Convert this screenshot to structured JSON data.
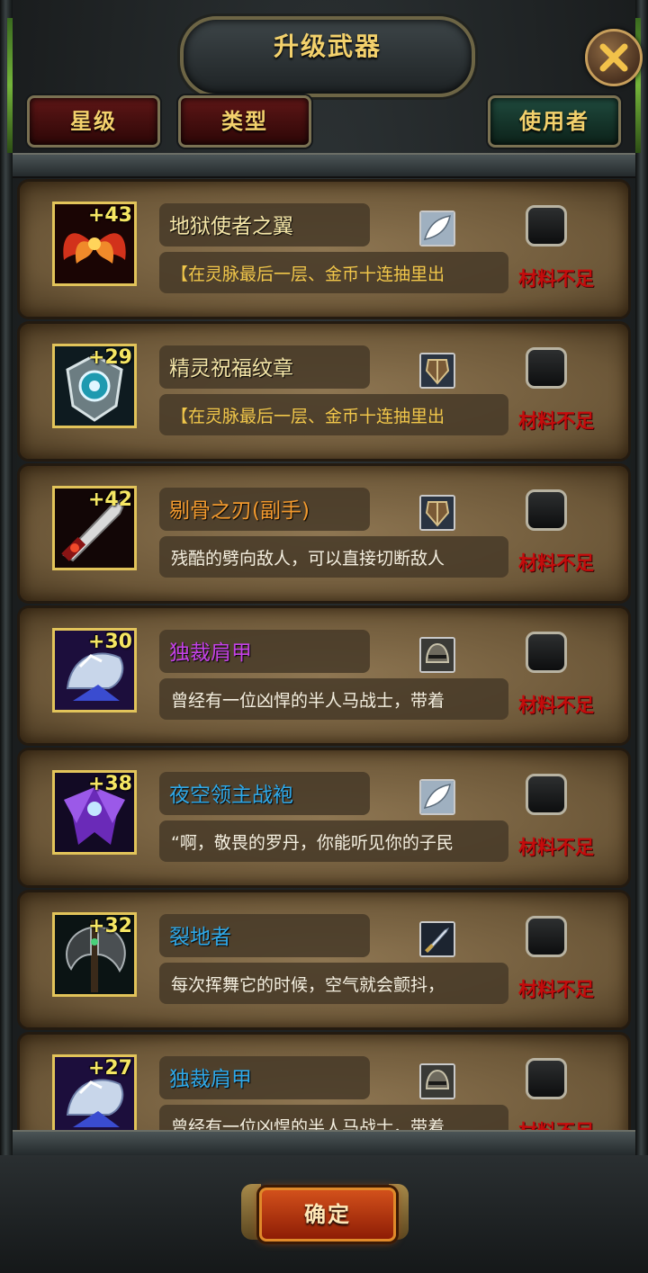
{
  "header": {
    "title": "升级武器",
    "close_icon": "close-x-icon"
  },
  "filters": [
    {
      "label": "星级",
      "color": "#5e1616"
    },
    {
      "label": "类型",
      "color": "#5e1616"
    },
    {
      "label": "使用者",
      "color": "#1f4a3d"
    }
  ],
  "items": [
    {
      "name": "地狱使者之翼",
      "plus": "+43",
      "name_color": "#f5e6a8",
      "desc": "【在灵脉最后一层、金币十连抽里出",
      "desc_color": "#f0c64a",
      "type_icon": "wing-type-icon",
      "status": "材料不足",
      "art": "wings-red"
    },
    {
      "name": "精灵祝福纹章",
      "plus": "+29",
      "name_color": "#f5e6a8",
      "desc": "【在灵脉最后一层、金币十连抽里出",
      "desc_color": "#f0c64a",
      "type_icon": "shield-type-icon",
      "status": "材料不足",
      "art": "emblem"
    },
    {
      "name": "剔骨之刃(副手)",
      "plus": "+42",
      "name_color": "#f39a2e",
      "desc": "残酷的劈向敌人，可以直接切断敌人",
      "desc_color": "#f4efe0",
      "type_icon": "shield-type-icon",
      "status": "材料不足",
      "art": "blade"
    },
    {
      "name": "独裁肩甲",
      "plus": "+30",
      "name_color": "#c441e6",
      "desc": "曾经有一位凶悍的半人马战士，带着",
      "desc_color": "#f4efe0",
      "type_icon": "helmet-type-icon",
      "status": "材料不足",
      "art": "pauldron"
    },
    {
      "name": "夜空领主战袍",
      "plus": "+38",
      "name_color": "#2fa8e8",
      "desc": "“啊，敬畏的罗丹，你能听见你的子民",
      "desc_color": "#f4efe0",
      "type_icon": "wing-type-icon",
      "status": "材料不足",
      "art": "robe"
    },
    {
      "name": "裂地者",
      "plus": "+32",
      "name_color": "#2fa8e8",
      "desc": "每次挥舞它的时候，空气就会颤抖，",
      "desc_color": "#f4efe0",
      "type_icon": "sword-type-icon",
      "status": "材料不足",
      "art": "axe"
    },
    {
      "name": "独裁肩甲",
      "plus": "+27",
      "name_color": "#2fa8e8",
      "desc": "曾经有一位凶悍的半人马战士，带着",
      "desc_color": "#f4efe0",
      "type_icon": "helmet-type-icon",
      "status": "材料不足",
      "art": "pauldron"
    }
  ],
  "footer": {
    "confirm_label": "确定"
  }
}
